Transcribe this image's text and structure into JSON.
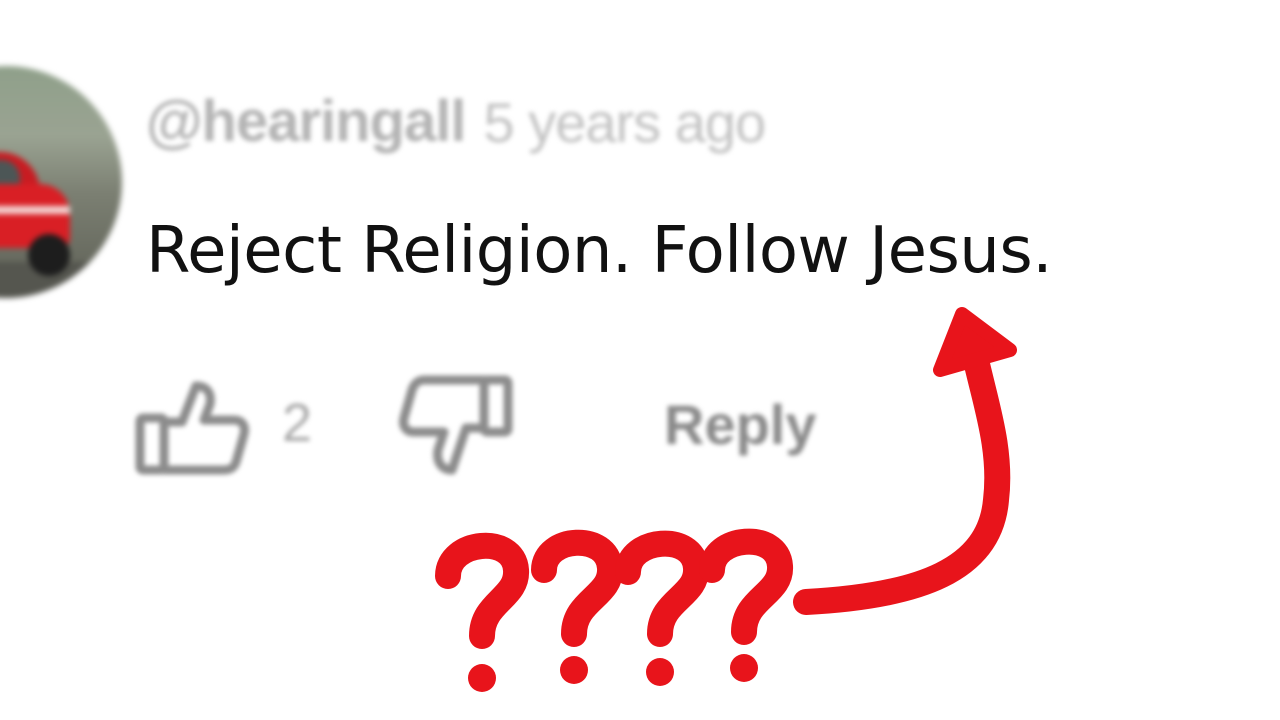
{
  "comment": {
    "author": "@hearingall",
    "timestamp": "5 years ago",
    "text": "Reject Religion. Follow Jesus.",
    "avatar_icon": "user-avatar-red-car"
  },
  "actions": {
    "like_icon": "thumbs-up-icon",
    "like_count": "2",
    "dislike_icon": "thumbs-down-icon",
    "reply_label": "Reply"
  },
  "annotation": {
    "question_marks": "????",
    "arrow_icon": "curved-arrow-icon",
    "color": "#e8141b"
  },
  "colors": {
    "background": "#ffffff",
    "comment_text": "#111111",
    "muted_text": "#b4b4b4",
    "annotation_red": "#e8141b"
  }
}
